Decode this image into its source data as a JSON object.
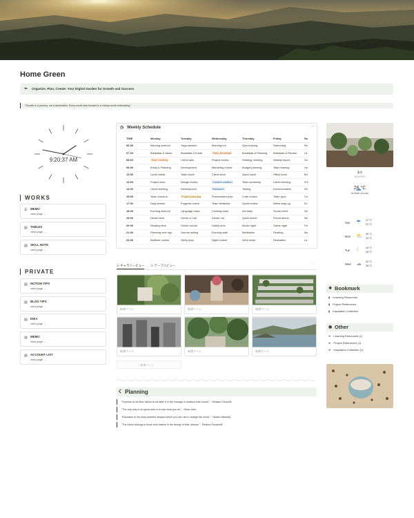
{
  "page": {
    "title": "Home Green",
    "callout": "Organize, Plan, Create: Your Digital Garden for Growth and Success",
    "quote": "\"Growth is a journey, not a destination. Every small step forward is a victory worth celebrating.\""
  },
  "clock": {
    "time": "9:20:37 AM"
  },
  "works": {
    "title": "WORKS",
    "items": [
      {
        "name": "MEMO",
        "link": "view page →",
        "icon": "memo-icon"
      },
      {
        "name": "TABLES",
        "link": "view page →",
        "icon": "table-icon"
      },
      {
        "name": "SKILL NOTE",
        "link": "view page →",
        "icon": "note-icon"
      }
    ]
  },
  "private": {
    "title": "PRIVATE",
    "items": [
      {
        "name": "NOTION TIPS",
        "link": "view page →"
      },
      {
        "name": "BLOG TIPS",
        "link": "view page →"
      },
      {
        "name": "IDEA",
        "link": "view page →"
      },
      {
        "name": "MEMO",
        "link": "view page →"
      },
      {
        "name": "ACCOUNT LIST",
        "link": "view page →"
      }
    ]
  },
  "schedule": {
    "title": "Weekly Schedule",
    "headers": [
      "TIME",
      "Monday",
      "Tuesday",
      "Wednesday",
      "Thursday",
      "Friday",
      "Sa"
    ],
    "rows": [
      [
        "06:00",
        "Morning workout",
        "Yoga session",
        "Morning run",
        "Gym training",
        "Swimming",
        "Re"
      ],
      [
        "07:00",
        "Breakfast & News",
        "Breakfast & Email",
        "Team Breakfast",
        "Breakfast & Planning",
        "Breakfast & Review",
        "La"
      ],
      [
        "08:00",
        "Team meeting",
        "Client calls",
        "Project review",
        "Strategy meeting",
        "Weekly report",
        "Go"
      ],
      [
        "09:00",
        "Email & Planning",
        "Development",
        "Marketing review",
        "Budget planning",
        "Team training",
        "Ho"
      ],
      [
        "12:00",
        "Lunch break",
        "Team lunch",
        "Client lunch",
        "Quick lunch",
        "Office lunch",
        "Bri"
      ],
      [
        "13:00",
        "Project work",
        "Design review",
        "Content creation",
        "Team workshop",
        "Client meeting",
        "Fre"
      ],
      [
        "14:00",
        "Client meeting",
        "Development",
        "Research",
        "Testing",
        "Documentation",
        "Sh"
      ],
      [
        "15:00",
        "Team check-in",
        "Project planning",
        "Presentation prep",
        "Code review",
        "Team sync",
        "Co"
      ],
      [
        "17:00",
        "Daily review",
        "Progress check",
        "Team feedback",
        "Sprint review",
        "Week wrap-up",
        "Ev"
      ],
      [
        "18:00",
        "Evening workout",
        "Language class",
        "Cooking class",
        "Art class",
        "Social event",
        "Dir"
      ],
      [
        "19:00",
        "Dinner time",
        "Dinner & Call",
        "Dinner out",
        "Quick dinner",
        "Friend dinner",
        "Ne"
      ],
      [
        "20:00",
        "Reading time",
        "Online course",
        "Hobby time",
        "Movie night",
        "Game night",
        "Pa"
      ],
      [
        "21:00",
        "Planning next day",
        "Journal writing",
        "Evening walk",
        "Meditation",
        "Reading",
        "Mo"
      ],
      [
        "22:00",
        "Bedtime routine",
        "Sleep prep",
        "Night routine",
        "Wind down",
        "Relaxation",
        "La"
      ]
    ],
    "tools": "⋮ ⤢"
  },
  "gallery": {
    "tabs": [
      "☷ ギャラリービュー",
      "☷ テーブルビュー"
    ],
    "more": "···",
    "card_caption": "新規ページ",
    "new_page": "+ 新規ページ"
  },
  "planning": {
    "title": "Planning",
    "quotes": [
      "\"Success is not final, failure is not fatal: It is the courage to continue that counts.\" - Winston Churchill",
      "\"The only way to do great work is to love what you do.\" - Steve Jobs",
      "\"Education is the most powerful weapon which you can use to change the world.\" - Nelson Mandela",
      "\"The future belongs to those who believe in the beauty of their dreams.\" - Eleanor Roosevelt"
    ]
  },
  "weather": {
    "city": "東京",
    "sub": "WEATHER",
    "temp": "26 °C",
    "desc": "broken clouds",
    "forecast": [
      {
        "day": "Sun",
        "hi": "27 °C",
        "lo": "22 °C",
        "icon": "rain-icon"
      },
      {
        "day": "Mon",
        "hi": "30 °C",
        "lo": "23 °C",
        "icon": "sun-cloud-icon"
      },
      {
        "day": "Tue",
        "hi": "34 °C",
        "lo": "25 °C",
        "icon": "moon-icon"
      },
      {
        "day": "Wed",
        "hi": "32 °C",
        "lo": "26 °C",
        "icon": "cloud-icon"
      }
    ]
  },
  "bookmark": {
    "title": "Bookmark",
    "items": [
      "Learning Resources",
      "Project References",
      "Inspiration Collection"
    ]
  },
  "other": {
    "title": "Other",
    "items": [
      "Learning Resources (1)",
      "Project References (1)",
      "Inspiration Collection (1)"
    ]
  },
  "colors": {
    "callout_bg": "#edf2ec",
    "text": "#37352f",
    "accent_green": "#3b5b3a"
  }
}
